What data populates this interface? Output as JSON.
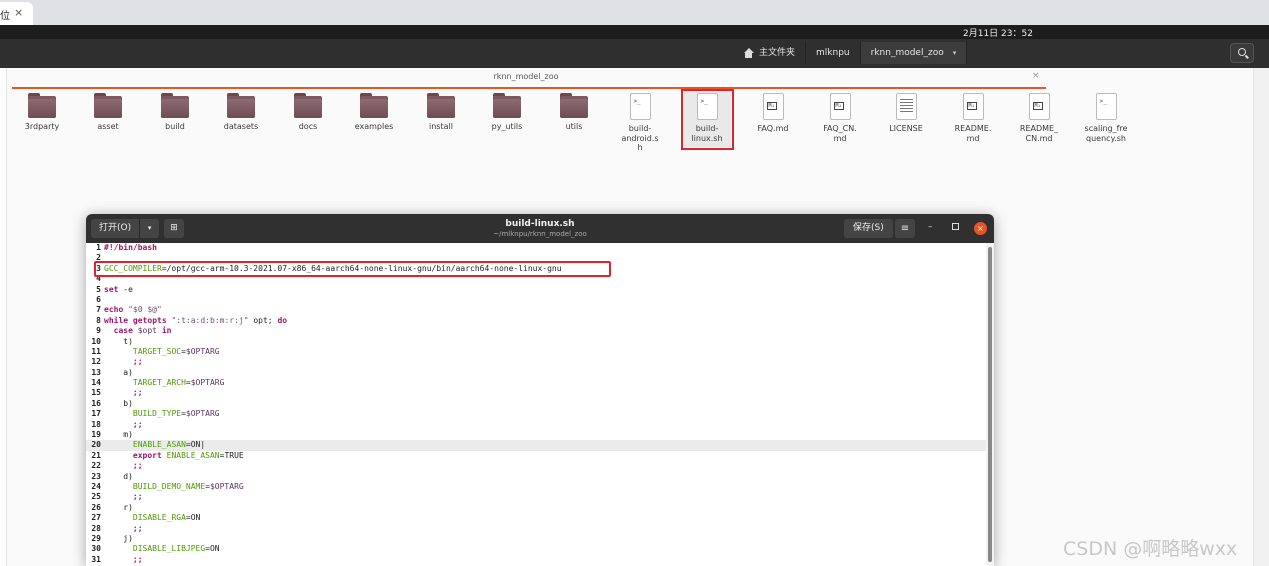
{
  "browser": {
    "tab_label": "位",
    "tab_close": "×"
  },
  "topbar": {
    "clock": "2月11日 23：52"
  },
  "files": {
    "path": [
      {
        "label": "主文件夹",
        "icon": "home-icon"
      },
      {
        "label": "mlknpu"
      },
      {
        "label": "rknn_model_zoo",
        "caret": "▾"
      }
    ],
    "location_tab": {
      "label": "rknn_model_zoo",
      "close": "×"
    },
    "items": [
      {
        "label": "3rdparty",
        "kind": "folder"
      },
      {
        "label": "asset",
        "kind": "folder"
      },
      {
        "label": "build",
        "kind": "folder"
      },
      {
        "label": "datasets",
        "kind": "folder"
      },
      {
        "label": "docs",
        "kind": "folder"
      },
      {
        "label": "examples",
        "kind": "folder"
      },
      {
        "label": "install",
        "kind": "folder"
      },
      {
        "label": "py_utils",
        "kind": "folder"
      },
      {
        "label": "utils",
        "kind": "folder"
      },
      {
        "label": "build-android.sh",
        "kind": "script"
      },
      {
        "label": "build-linux.sh",
        "kind": "script"
      },
      {
        "label": "FAQ.md",
        "kind": "markdown"
      },
      {
        "label": "FAQ_CN.md",
        "kind": "markdown"
      },
      {
        "label": "LICENSE",
        "kind": "text"
      },
      {
        "label": "README.md",
        "kind": "markdown"
      },
      {
        "label": "README_CN.md",
        "kind": "markdown"
      },
      {
        "label": "scaling_frequency.sh",
        "kind": "script"
      }
    ]
  },
  "editor": {
    "open_label": "打开(O)",
    "open_caret": "▾",
    "newtab_icon": "⊞",
    "title": "build-linux.sh",
    "subtitle": "~/mlknpu/rknn_model_zoo",
    "save_label": "保存(S)",
    "menu_icon": "≡",
    "min_icon": "–",
    "close_icon": "×",
    "lines": [
      {
        "n": "1",
        "parts": [
          [
            "kw",
            "#!/bin/bash"
          ]
        ]
      },
      {
        "n": "2",
        "parts": []
      },
      {
        "n": "3",
        "parts": [
          [
            "vr",
            "GCC_COMPILER"
          ],
          [
            "tx",
            "=/opt/gcc-arm-10.3-2021.07-x86_64-aarch64-none-linux-gnu/bin/aarch64-none-linux-gnu"
          ]
        ]
      },
      {
        "n": "4",
        "parts": []
      },
      {
        "n": "5",
        "parts": [
          [
            "kw",
            "set"
          ],
          [
            "tx",
            " -e"
          ]
        ]
      },
      {
        "n": "6",
        "parts": []
      },
      {
        "n": "7",
        "parts": [
          [
            "kw",
            "echo"
          ],
          [
            "tx",
            " "
          ],
          [
            "st",
            "\"$0 $@\""
          ]
        ]
      },
      {
        "n": "8",
        "parts": [
          [
            "kw",
            "while"
          ],
          [
            "tx",
            " "
          ],
          [
            "kw",
            "getopts"
          ],
          [
            "tx",
            " "
          ],
          [
            "st",
            "\":t:a:d:b:m:r:j\""
          ],
          [
            "tx",
            " opt; "
          ],
          [
            "kw",
            "do"
          ]
        ]
      },
      {
        "n": "9",
        "parts": [
          [
            "tx",
            "  "
          ],
          [
            "kw",
            "case"
          ],
          [
            "tx",
            " "
          ],
          [
            "dl",
            "$opt"
          ],
          [
            "tx",
            " "
          ],
          [
            "kw",
            "in"
          ]
        ]
      },
      {
        "n": "10",
        "parts": [
          [
            "tx",
            "    t)"
          ]
        ]
      },
      {
        "n": "11",
        "parts": [
          [
            "tx",
            "      "
          ],
          [
            "vr",
            "TARGET_SOC"
          ],
          [
            "tx",
            "="
          ],
          [
            "dl",
            "$OPTARG"
          ]
        ]
      },
      {
        "n": "12",
        "parts": [
          [
            "tx",
            "      "
          ],
          [
            "kw",
            ";;"
          ]
        ]
      },
      {
        "n": "13",
        "parts": [
          [
            "tx",
            "    a)"
          ]
        ]
      },
      {
        "n": "14",
        "parts": [
          [
            "tx",
            "      "
          ],
          [
            "vr",
            "TARGET_ARCH"
          ],
          [
            "tx",
            "="
          ],
          [
            "dl",
            "$OPTARG"
          ]
        ]
      },
      {
        "n": "15",
        "parts": [
          [
            "tx",
            "      "
          ],
          [
            "kw",
            ";;"
          ]
        ]
      },
      {
        "n": "16",
        "parts": [
          [
            "tx",
            "    b)"
          ]
        ]
      },
      {
        "n": "17",
        "parts": [
          [
            "tx",
            "      "
          ],
          [
            "vr",
            "BUILD_TYPE"
          ],
          [
            "tx",
            "="
          ],
          [
            "dl",
            "$OPTARG"
          ]
        ]
      },
      {
        "n": "18",
        "parts": [
          [
            "tx",
            "      "
          ],
          [
            "kw",
            ";;"
          ]
        ]
      },
      {
        "n": "19",
        "parts": [
          [
            "tx",
            "    m)"
          ]
        ]
      },
      {
        "n": "20",
        "parts": [
          [
            "tx",
            "      "
          ],
          [
            "vr",
            "ENABLE_ASAN"
          ],
          [
            "tx",
            "=ON|"
          ]
        ],
        "current": true
      },
      {
        "n": "21",
        "parts": [
          [
            "tx",
            "      "
          ],
          [
            "kw",
            "export"
          ],
          [
            "tx",
            " "
          ],
          [
            "vr",
            "ENABLE_ASAN"
          ],
          [
            "tx",
            "=TRUE"
          ]
        ]
      },
      {
        "n": "22",
        "parts": [
          [
            "tx",
            "      "
          ],
          [
            "kw",
            ";;"
          ]
        ]
      },
      {
        "n": "23",
        "parts": [
          [
            "tx",
            "    d)"
          ]
        ]
      },
      {
        "n": "24",
        "parts": [
          [
            "tx",
            "      "
          ],
          [
            "vr",
            "BUILD_DEMO_NAME"
          ],
          [
            "tx",
            "="
          ],
          [
            "dl",
            "$OPTARG"
          ]
        ]
      },
      {
        "n": "25",
        "parts": [
          [
            "tx",
            "      "
          ],
          [
            "kw",
            ";;"
          ]
        ]
      },
      {
        "n": "26",
        "parts": [
          [
            "tx",
            "    r)"
          ]
        ]
      },
      {
        "n": "27",
        "parts": [
          [
            "tx",
            "      "
          ],
          [
            "vr",
            "DISABLE_RGA"
          ],
          [
            "tx",
            "=ON"
          ]
        ]
      },
      {
        "n": "28",
        "parts": [
          [
            "tx",
            "      "
          ],
          [
            "kw",
            ";;"
          ]
        ]
      },
      {
        "n": "29",
        "parts": [
          [
            "tx",
            "    j)"
          ]
        ]
      },
      {
        "n": "30",
        "parts": [
          [
            "tx",
            "      "
          ],
          [
            "vr",
            "DISABLE_LIBJPEG"
          ],
          [
            "tx",
            "=ON"
          ]
        ]
      },
      {
        "n": "31",
        "parts": [
          [
            "tx",
            "      "
          ],
          [
            "kw",
            ";;"
          ]
        ]
      }
    ]
  },
  "watermark": "CSDN @啊略略wxx",
  "colors": {
    "accent": "#e95420",
    "annotation": "#e0242b",
    "folder": "#7c5a62"
  }
}
